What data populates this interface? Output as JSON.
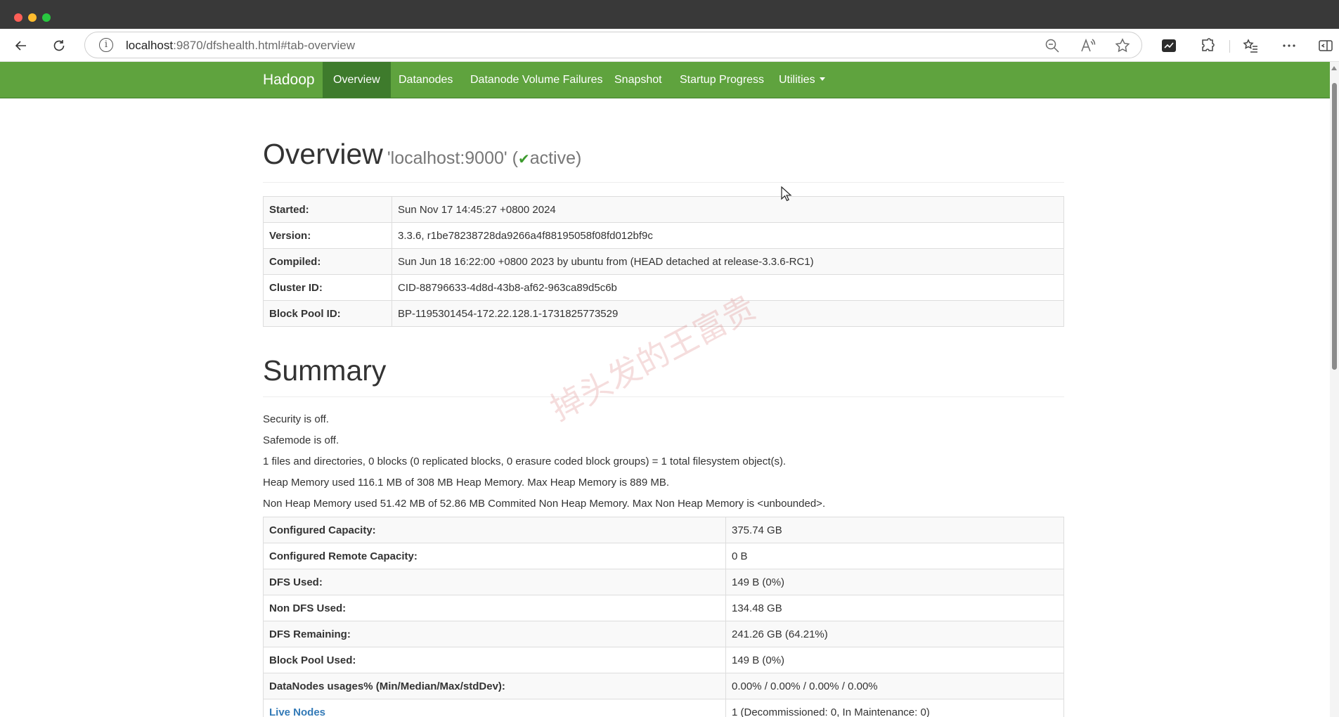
{
  "browser": {
    "url_host": "localhost",
    "url_rest": ":9870/dfshealth.html#tab-overview"
  },
  "navbar": {
    "brand": "Hadoop",
    "items": [
      {
        "label": "Overview"
      },
      {
        "label": "Datanodes"
      },
      {
        "label": "Datanode Volume Failures"
      },
      {
        "label": "Snapshot"
      },
      {
        "label": "Startup Progress"
      },
      {
        "label": "Utilities"
      }
    ]
  },
  "overview": {
    "title": "Overview",
    "host": "'localhost:9000' (",
    "check": "✔",
    "state": "active)",
    "rows": [
      {
        "key": "Started:",
        "value": "Sun Nov 17 14:45:27 +0800 2024"
      },
      {
        "key": "Version:",
        "value": "3.3.6, r1be78238728da9266a4f88195058f08fd012bf9c"
      },
      {
        "key": "Compiled:",
        "value": "Sun Jun 18 16:22:00 +0800 2023 by ubuntu from (HEAD detached at release-3.3.6-RC1)"
      },
      {
        "key": "Cluster ID:",
        "value": "CID-88796633-4d8d-43b8-af62-963ca89d5c6b"
      },
      {
        "key": "Block Pool ID:",
        "value": "BP-1195301454-172.22.128.1-1731825773529"
      }
    ]
  },
  "summary": {
    "title": "Summary",
    "lines": [
      "Security is off.",
      "Safemode is off.",
      "1 files and directories, 0 blocks (0 replicated blocks, 0 erasure coded block groups) = 1 total filesystem object(s).",
      "Heap Memory used 116.1 MB of 308 MB Heap Memory. Max Heap Memory is 889 MB.",
      "Non Heap Memory used 51.42 MB of 52.86 MB Commited Non Heap Memory. Max Non Heap Memory is <unbounded>."
    ],
    "rows": [
      {
        "key": "Configured Capacity:",
        "value": "375.74 GB"
      },
      {
        "key": "Configured Remote Capacity:",
        "value": "0 B"
      },
      {
        "key": "DFS Used:",
        "value": "149 B (0%)"
      },
      {
        "key": "Non DFS Used:",
        "value": "134.48 GB"
      },
      {
        "key": "DFS Remaining:",
        "value": "241.26 GB (64.21%)"
      },
      {
        "key": "Block Pool Used:",
        "value": "149 B (0%)"
      },
      {
        "key": "DataNodes usages% (Min/Median/Max/stdDev):",
        "value": "0.00% / 0.00% / 0.00% / 0.00%"
      },
      {
        "key": "Live Nodes",
        "value": "1 (Decommissioned: 0, In Maintenance: 0)"
      }
    ]
  },
  "watermark": "掉头发的王富贵"
}
